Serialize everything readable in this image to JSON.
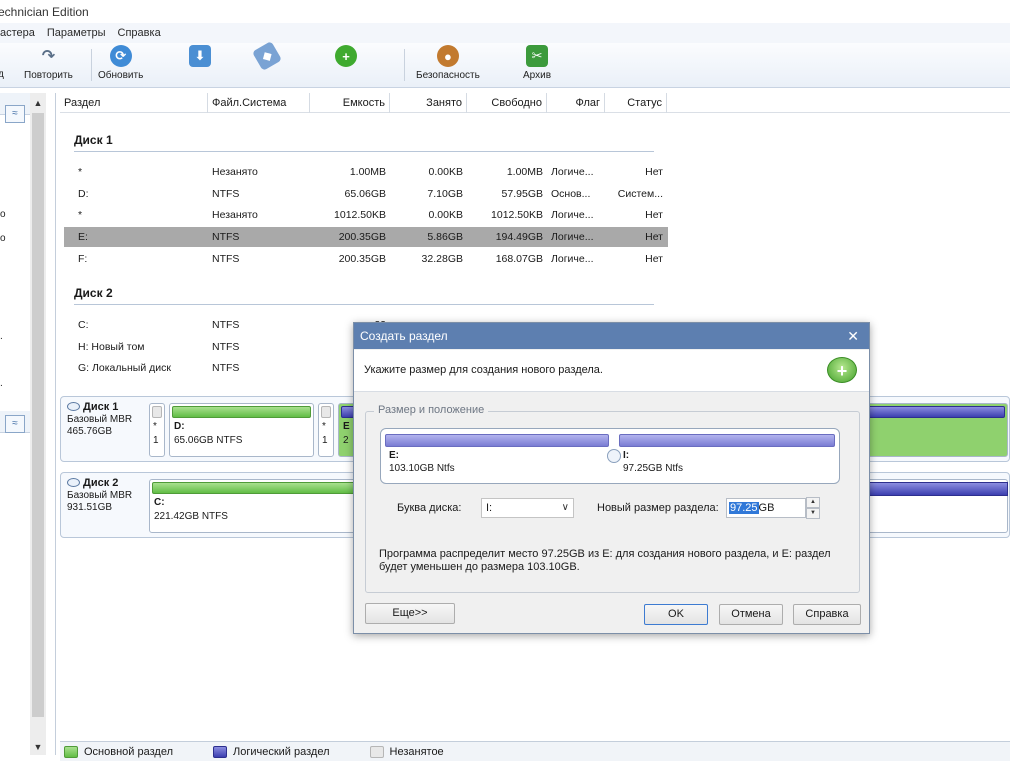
{
  "window": {
    "title": "echnician Edition"
  },
  "menu": [
    "астера",
    "Параметры",
    "Справка"
  ],
  "toolbar": {
    "undo_label": "д",
    "redo_label": "Повторить",
    "refresh_label": "Обновить",
    "security_label": "Безопасность",
    "archive_label": "Архив"
  },
  "columns": [
    "Раздел",
    "Файл.Система",
    "Емкость",
    "Занято",
    "Свободно",
    "Флаг",
    "Статус"
  ],
  "disks": [
    {
      "title": "Диск 1",
      "rows": [
        {
          "part": "*",
          "fs": "Незанято",
          "cap": "1.00MB",
          "used": "0.00KB",
          "free": "1.00MB",
          "flag": "Логиче...",
          "status": "Нет"
        },
        {
          "part": "D:",
          "fs": "NTFS",
          "cap": "65.06GB",
          "used": "7.10GB",
          "free": "57.95GB",
          "flag": "Основ...",
          "status": "Систем..."
        },
        {
          "part": "*",
          "fs": "Незанято",
          "cap": "1012.50KB",
          "used": "0.00KB",
          "free": "1012.50KB",
          "flag": "Логиче...",
          "status": "Нет"
        },
        {
          "part": "E:",
          "fs": "NTFS",
          "cap": "200.35GB",
          "used": "5.86GB",
          "free": "194.49GB",
          "flag": "Логиче...",
          "status": "Нет",
          "selected": true
        },
        {
          "part": "F:",
          "fs": "NTFS",
          "cap": "200.35GB",
          "used": "32.28GB",
          "free": "168.07GB",
          "flag": "Логиче...",
          "status": "Нет"
        }
      ]
    },
    {
      "title": "Диск 2",
      "rows": [
        {
          "part": "C:",
          "fs": "NTFS",
          "cap": "22",
          "used": "",
          "free": "",
          "flag": "",
          "status": ""
        },
        {
          "part": "H: Новый том",
          "fs": "NTFS",
          "cap": "21",
          "used": "",
          "free": "",
          "flag": "",
          "status": ""
        },
        {
          "part": "G: Локальный диск",
          "fs": "NTFS",
          "cap": "49",
          "used": "",
          "free": "",
          "flag": "",
          "status": ""
        }
      ]
    }
  ],
  "diskmaps": [
    {
      "name": "Диск 1",
      "type": "Базовый MBR",
      "size": "465.76GB",
      "seg1_star": "*",
      "seg1_num": "1",
      "seg2_name": "D:",
      "seg2_desc": "65.06GB NTFS",
      "seg3_star": "*",
      "seg3_num": "1",
      "seg4_name": "E",
      "seg4_num": "2"
    },
    {
      "name": "Диск 2",
      "type": "Базовый MBR",
      "size": "931.51GB",
      "seg1_name": "C:",
      "seg1_desc": "221.42GB NTFS"
    }
  ],
  "legend": {
    "primary": "Основной раздел",
    "logical": "Логический раздел",
    "unallocated": "Незанятое"
  },
  "dialog": {
    "title": "Создать раздел",
    "close": "✕",
    "hint": "Укажите размер для создания нового раздела.",
    "group_title": "Размер и положение",
    "left_part_name": "E:",
    "left_part_desc": "103.10GB Ntfs",
    "right_part_name": "I:",
    "right_part_desc": "97.25GB Ntfs",
    "drive_letter_label": "Буква диска:",
    "drive_letter_value": "I:",
    "new_size_label": "Новый размер раздела:",
    "new_size_value_selected": "97.25",
    "new_size_value_unit": "GB",
    "note": "Программа распределит место 97.25GB из E: для создания нового раздела, и E: раздел будет уменьшен до размера 103.10GB.",
    "more_btn": "Еще>>",
    "ok_btn": "OK",
    "cancel_btn": "Отмена",
    "help_btn": "Справка"
  }
}
